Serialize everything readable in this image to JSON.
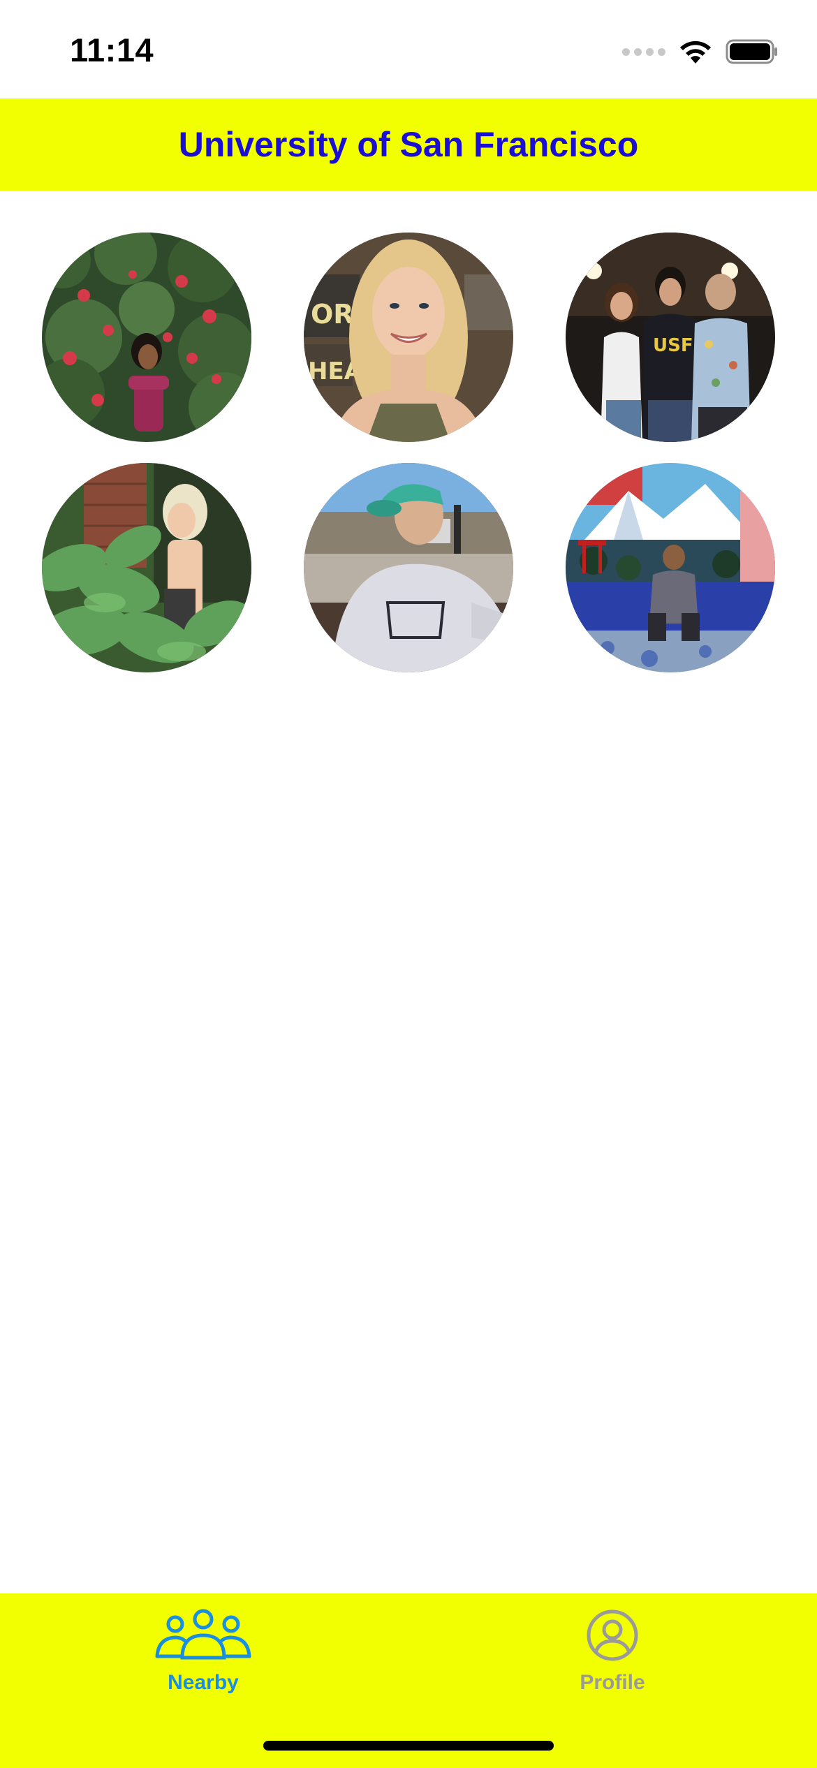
{
  "status_bar": {
    "time": "11:14"
  },
  "header": {
    "title": "University of San Francisco"
  },
  "grid": {
    "photos": [
      {
        "name": "profile-photo-1"
      },
      {
        "name": "profile-photo-2"
      },
      {
        "name": "profile-photo-3"
      },
      {
        "name": "profile-photo-4"
      },
      {
        "name": "profile-photo-5"
      },
      {
        "name": "profile-photo-6"
      }
    ]
  },
  "tab_bar": {
    "tabs": [
      {
        "label": "Nearby",
        "icon": "people-icon",
        "active": true
      },
      {
        "label": "Profile",
        "icon": "person-circle-icon",
        "active": false
      }
    ]
  },
  "colors": {
    "header_background": "#f2ff00",
    "header_title": "#1b0fd4",
    "tab_active": "#1a8fe0",
    "tab_inactive": "#9a9a9a"
  }
}
